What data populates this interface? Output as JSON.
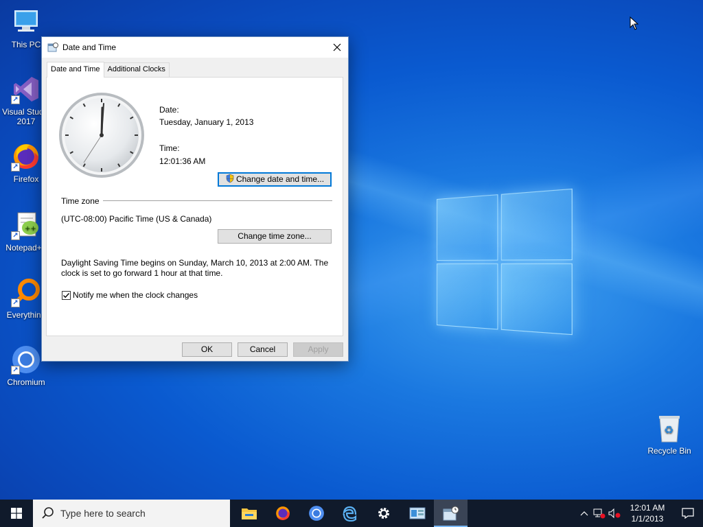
{
  "desktop": {
    "icons": [
      {
        "label": "This PC"
      },
      {
        "label": "Visual Studio 2017"
      },
      {
        "label": "Firefox"
      },
      {
        "label": "Notepad++"
      },
      {
        "label": "Everything"
      },
      {
        "label": "Chromium"
      },
      {
        "label": "Recycle Bin"
      }
    ]
  },
  "dialog": {
    "title": "Date and Time",
    "tabs": [
      {
        "label": "Date and Time",
        "active": true
      },
      {
        "label": "Additional Clocks",
        "active": false
      }
    ],
    "date_label": "Date:",
    "date_value": "Tuesday, January 1, 2013",
    "time_label": "Time:",
    "time_value": "12:01:36 AM",
    "change_datetime_button": "Change date and time...",
    "timezone_header": "Time zone",
    "timezone_value": "(UTC-08:00) Pacific Time (US & Canada)",
    "change_timezone_button": "Change time zone...",
    "dst_line1": "Daylight Saving Time begins on Sunday, March 10, 2013 at 2:00 AM. The",
    "dst_line2": "clock is set to go forward 1 hour at that time.",
    "notify_checkbox_label": "Notify me when the clock changes",
    "notify_checked": true,
    "ok_button": "OK",
    "cancel_button": "Cancel",
    "apply_button": "Apply"
  },
  "taskbar": {
    "search_placeholder": "Type here to search",
    "apps": [
      "file-explorer-icon",
      "firefox-icon",
      "chromium-icon",
      "edge-legacy-icon",
      "settings-icon",
      "control-panel-icon",
      "date-time-icon"
    ],
    "clock_time": "12:01 AM",
    "clock_date": "1/1/2013"
  }
}
